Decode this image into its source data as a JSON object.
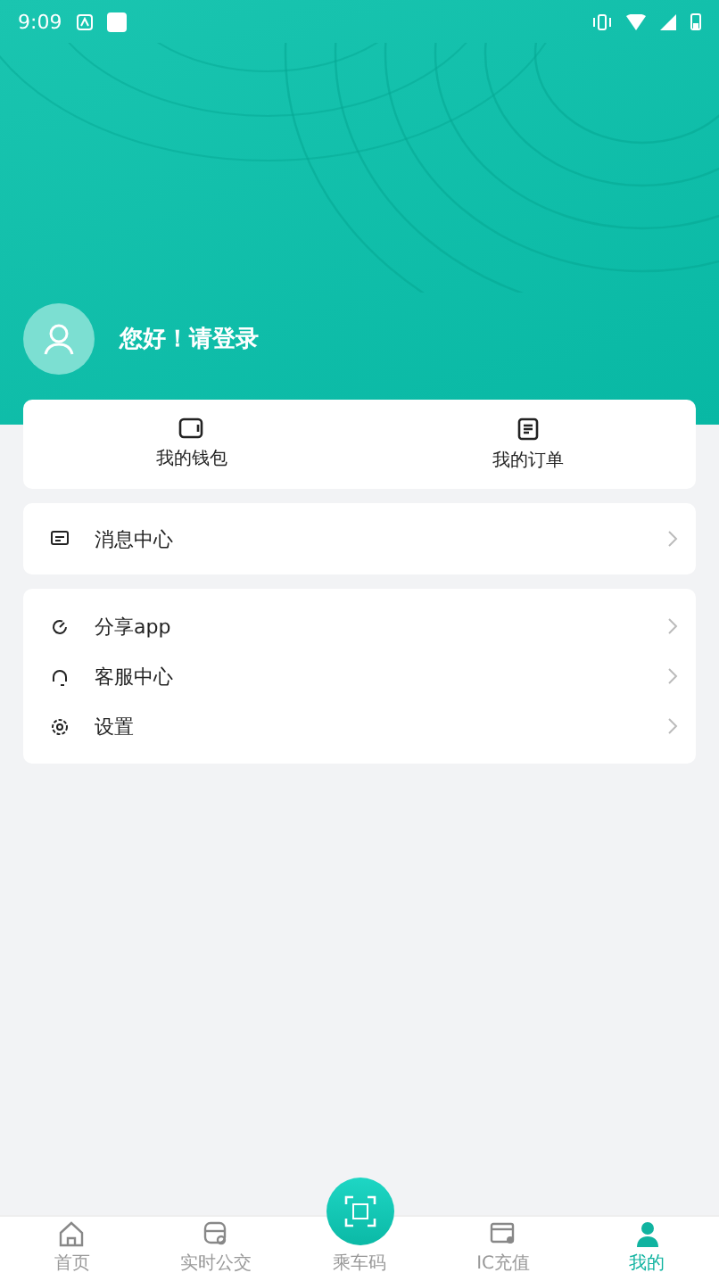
{
  "status_bar": {
    "time": "9:09"
  },
  "profile": {
    "greeting": "您好！请登录"
  },
  "quick_actions": [
    {
      "kind": "wallet",
      "label": "我的钱包"
    },
    {
      "kind": "orders",
      "label": "我的订单"
    }
  ],
  "menu_groups": [
    [
      {
        "kind": "message",
        "label": "消息中心"
      }
    ],
    [
      {
        "kind": "share",
        "label": "分享app"
      },
      {
        "kind": "service",
        "label": "客服中心"
      },
      {
        "kind": "settings",
        "label": "设置"
      }
    ]
  ],
  "tab_bar": [
    {
      "kind": "home",
      "label": "首页",
      "selected": false
    },
    {
      "kind": "bus",
      "label": "实时公交",
      "selected": false
    },
    {
      "kind": "scan",
      "label": "乘车码",
      "selected": false
    },
    {
      "kind": "card",
      "label": "IC充值",
      "selected": false
    },
    {
      "kind": "me",
      "label": "我的",
      "selected": true
    }
  ]
}
